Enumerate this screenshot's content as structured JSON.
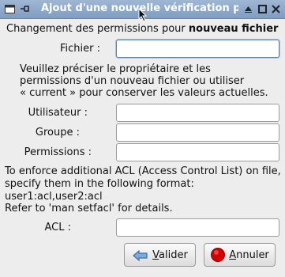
{
  "window": {
    "title": "Ajout d'une nouvelle vérification pér"
  },
  "header": {
    "prefix": "Changement des permissions pour ",
    "target": "nouveau fichier"
  },
  "fichier": {
    "label": "Fichier :",
    "value": ""
  },
  "instructions": [
    "Veuillez préciser le propriétaire et les",
    "permissions d'un nouveau fichier ou utiliser",
    "« current » pour conserver les valeurs actuelles."
  ],
  "fields": {
    "user": {
      "label": "Utilisateur :",
      "value": ""
    },
    "group": {
      "label": "Groupe :",
      "value": ""
    },
    "perms": {
      "label": "Permissions :",
      "value": ""
    }
  },
  "acl_help": [
    "To enforce additional ACL (Access Control List) on file,",
    "specify them in the following format:",
    "user1:acl,user2:acl",
    "Refer to 'man setfacl' for details."
  ],
  "acl": {
    "label": "ACL :",
    "value": ""
  },
  "buttons": {
    "ok": {
      "mnemonic": "V",
      "rest": "alider"
    },
    "cancel": {
      "mnemonic": "A",
      "rest": "nnuler"
    }
  },
  "colors": {
    "titlebar": "#7f9dc2",
    "focus": "#5d83b0",
    "cancel_icon": "#d40000",
    "ok_icon": "#4a7fc1"
  }
}
